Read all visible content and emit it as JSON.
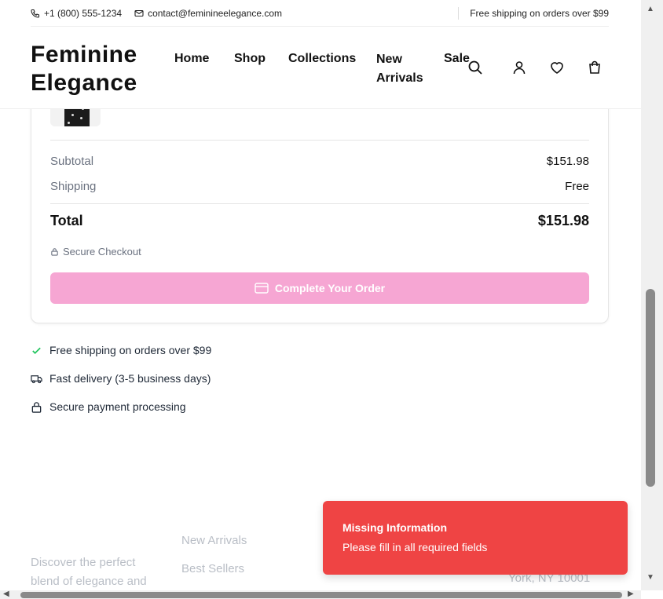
{
  "topbar": {
    "phone": "+1 (800) 555-1234",
    "email": "contact@feminineelegance.com",
    "shipping_note": "Free shipping on orders over $99"
  },
  "header": {
    "logo_line1": "Feminine",
    "logo_line2": "Elegance",
    "nav": {
      "home": "Home",
      "shop": "Shop",
      "collections": "Collections",
      "new_arrivals_line1": "New",
      "new_arrivals_line2": "Arrivals",
      "sale": "Sale"
    },
    "icons": [
      "search-icon",
      "user-icon",
      "heart-icon",
      "cart-icon"
    ]
  },
  "summary": {
    "subtotal_label": "Subtotal",
    "subtotal_value": "$151.98",
    "shipping_label": "Shipping",
    "shipping_value": "Free",
    "total_label": "Total",
    "total_value": "$151.98",
    "secure_note": "Secure Checkout",
    "complete_button": "Complete Your Order",
    "button_color": "#f6a6d3"
  },
  "perks": [
    {
      "icon": "check-icon",
      "text": "Free shipping on orders over $99"
    },
    {
      "icon": "truck-icon",
      "text": "Fast delivery (3-5 business days)"
    },
    {
      "icon": "lock-icon",
      "text": "Secure payment processing"
    }
  ],
  "footer": {
    "tagline_line1": "Discover the perfect",
    "tagline_line2": "blend of elegance and",
    "link1": "New Arrivals",
    "link2": "Best Sellers",
    "address_partial": "York, NY 10001"
  },
  "toast": {
    "title": "Missing Information",
    "message": "Please fill in all required fields",
    "color": "#ef4444"
  }
}
